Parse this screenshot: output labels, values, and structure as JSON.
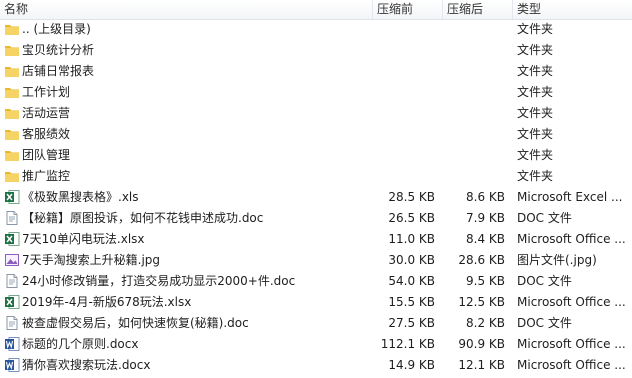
{
  "columns": {
    "name": "名称",
    "orig": "压缩前",
    "comp": "压缩后",
    "type": "类型"
  },
  "colors": {
    "folder": "#e8b92c",
    "excel": "#1e7145",
    "word": "#2b579a",
    "image": "#8b5fbf"
  },
  "rows": [
    {
      "icon": "folder",
      "name": ".. (上级目录)",
      "orig": "",
      "comp": "",
      "type": "文件夹"
    },
    {
      "icon": "folder",
      "name": "宝贝统计分析",
      "orig": "",
      "comp": "",
      "type": "文件夹"
    },
    {
      "icon": "folder",
      "name": "店铺日常报表",
      "orig": "",
      "comp": "",
      "type": "文件夹"
    },
    {
      "icon": "folder",
      "name": "工作计划",
      "orig": "",
      "comp": "",
      "type": "文件夹"
    },
    {
      "icon": "folder",
      "name": "活动运营",
      "orig": "",
      "comp": "",
      "type": "文件夹"
    },
    {
      "icon": "folder",
      "name": "客服绩效",
      "orig": "",
      "comp": "",
      "type": "文件夹"
    },
    {
      "icon": "folder",
      "name": "团队管理",
      "orig": "",
      "comp": "",
      "type": "文件夹"
    },
    {
      "icon": "folder",
      "name": "推广监控",
      "orig": "",
      "comp": "",
      "type": "文件夹"
    },
    {
      "icon": "excel",
      "name": "《极致黑搜表格》.xls",
      "orig": "28.5 KB",
      "comp": "8.6 KB",
      "type": "Microsoft Excel ..."
    },
    {
      "icon": "doc",
      "name": "【秘籍】原图投诉，如何不花钱申述成功.doc",
      "orig": "26.5 KB",
      "comp": "7.9 KB",
      "type": "DOC 文件"
    },
    {
      "icon": "excel",
      "name": "7天10单闪电玩法.xlsx",
      "orig": "11.0 KB",
      "comp": "8.4 KB",
      "type": "Microsoft Office ..."
    },
    {
      "icon": "image",
      "name": "7天手淘搜索上升秘籍.jpg",
      "orig": "30.0 KB",
      "comp": "28.6 KB",
      "type": "图片文件(.jpg)"
    },
    {
      "icon": "doc",
      "name": "24小时修改销量，打造交易成功显示2000+件.doc",
      "orig": "54.0 KB",
      "comp": "9.5 KB",
      "type": "DOC 文件"
    },
    {
      "icon": "excel",
      "name": "2019年-4月-新版678玩法.xlsx",
      "orig": "15.5 KB",
      "comp": "12.5 KB",
      "type": "Microsoft Office ..."
    },
    {
      "icon": "doc",
      "name": "被查虚假交易后，如何快速恢复(秘籍).doc",
      "orig": "27.5 KB",
      "comp": "8.2 KB",
      "type": "DOC 文件"
    },
    {
      "icon": "word",
      "name": "标题的几个原则.docx",
      "orig": "112.1 KB",
      "comp": "90.9 KB",
      "type": "Microsoft Office ..."
    },
    {
      "icon": "word",
      "name": "猜你喜欢搜索玩法.docx",
      "orig": "14.9 KB",
      "comp": "12.1 KB",
      "type": "Microsoft Office ..."
    }
  ]
}
